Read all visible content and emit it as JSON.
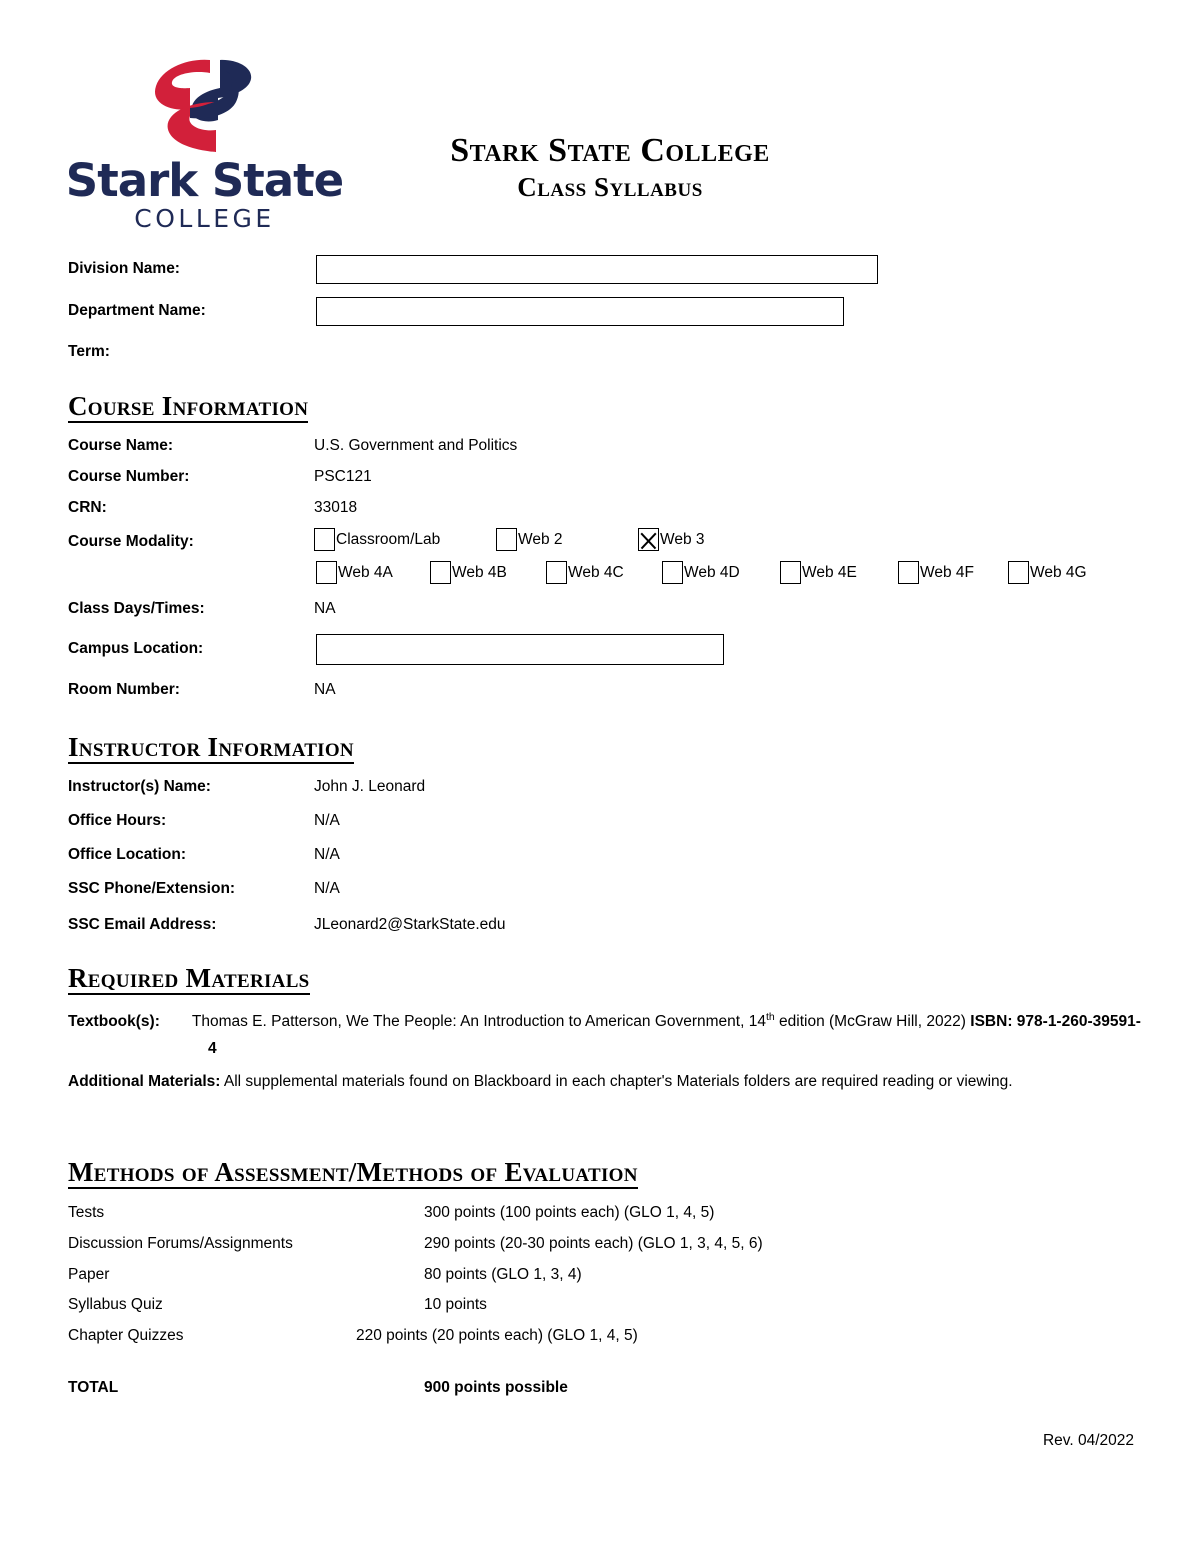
{
  "header": {
    "logo": {
      "wordmark": "Stark State",
      "sub": "COLLEGE",
      "mark_navy": "#1f2a56",
      "mark_red": "#d2203a"
    },
    "title": "Stark State College",
    "subtitle": "Class Syllabus"
  },
  "top_form": {
    "division_label": "Division Name:",
    "division_value": "",
    "department_label": "Department Name:",
    "department_value": "",
    "term_label": "Term:",
    "term_value": ""
  },
  "course_information": {
    "heading": "Course Information",
    "rows": [
      {
        "label": "Course Name:",
        "value": "U.S. Government and Politics"
      },
      {
        "label": "Course Number:",
        "value": "PSC121"
      },
      {
        "label": "CRN:",
        "value": "33018"
      }
    ],
    "modality_label": "Course Modality:",
    "modality_options_row1": [
      {
        "label": "Classroom/Lab",
        "checked": false
      },
      {
        "label": "Web 2",
        "checked": false
      },
      {
        "label": "Web 3",
        "checked": true
      }
    ],
    "modality_options_row2": [
      {
        "label": "Web 4A",
        "checked": false
      },
      {
        "label": "Web 4B",
        "checked": false
      },
      {
        "label": "Web 4C",
        "checked": false
      },
      {
        "label": "Web 4D",
        "checked": false
      },
      {
        "label": "Web 4E",
        "checked": false
      },
      {
        "label": "Web 4F",
        "checked": false
      },
      {
        "label": "Web 4G",
        "checked": false
      }
    ],
    "class_days_label": "Class Days/Times:",
    "class_days_value": "NA",
    "campus_location_label": "Campus Location:",
    "campus_location_value": "",
    "room_number_label": "Room Number:",
    "room_number_value": "NA"
  },
  "instructor_information": {
    "heading": "Instructor Information",
    "rows": [
      {
        "label": "Instructor(s) Name:",
        "value": "John J. Leonard"
      },
      {
        "label": "Office Hours:",
        "value": "N/A"
      },
      {
        "label": "Office Location:",
        "value": "N/A"
      },
      {
        "label": "SSC Phone/Extension:",
        "value": "N/A"
      },
      {
        "label": "SSC Email Address:",
        "value": "JLeonard2@StarkState.edu"
      }
    ]
  },
  "required_materials": {
    "heading": "Required Materials",
    "textbook_label": "Textbook(s):",
    "textbook_text_pre": "Thomas E. Patterson, We The People: An Introduction to American Government, 14",
    "textbook_sup": "th",
    "textbook_text_post": " edition (McGraw Hill, 2022) ",
    "isbn_label": "ISBN:",
    "isbn_value": " 978-1-260-39591-4",
    "additional_label": "Additional Materials:",
    "additional_text": " All supplemental materials found on Blackboard in each chapter's Materials folders are required reading or viewing."
  },
  "assessment": {
    "heading": "Methods of Assessment/Methods of Evaluation",
    "rows": [
      {
        "name": "Tests",
        "value": "300 points (100 points each) (GLO 1, 4, 5)"
      },
      {
        "name": "Discussion Forums/Assignments",
        "value": "290 points (20-30 points each) (GLO 1, 3, 4, 5, 6)"
      },
      {
        "name": "Paper",
        "value": "80 points (GLO 1, 3, 4)"
      },
      {
        "name": "Syllabus Quiz",
        "value": "10 points"
      },
      {
        "name": "Chapter Quizzes",
        "value": "220 points (20 points each) (GLO 1, 4, 5)"
      }
    ],
    "total_label": "TOTAL",
    "total_value": "900 points possible"
  },
  "footer": {
    "revision": "Rev. 04/2022"
  }
}
